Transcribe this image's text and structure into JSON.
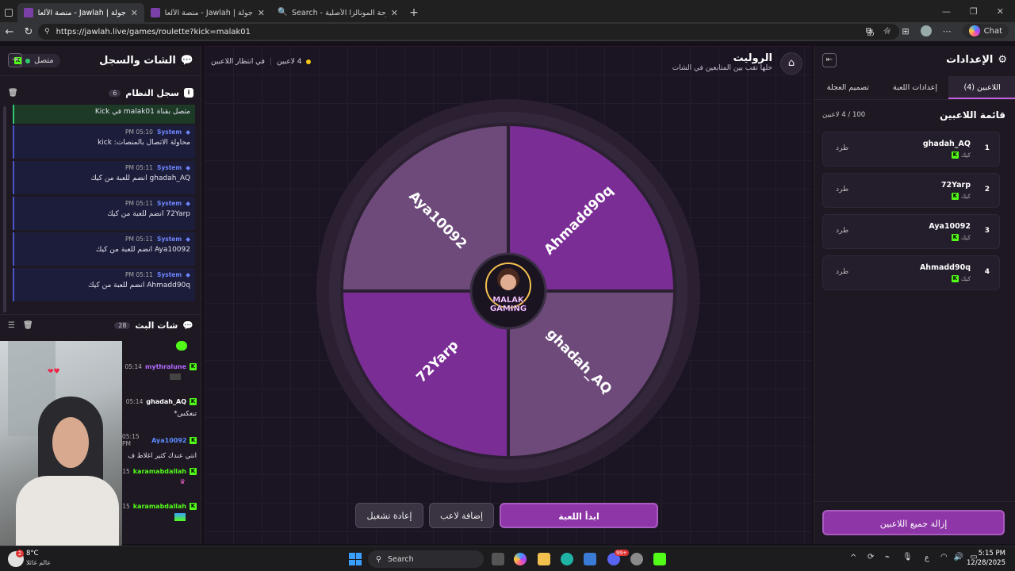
{
  "browser": {
    "tabs": [
      {
        "label": "جولة | Jawlah - منصة الألعاب التفاعلية",
        "active": true
      },
      {
        "label": "جولة | Jawlah - منصة الألعاب التفاعلية",
        "active": false
      },
      {
        "label": "Search - لوحة المونالزا الأصلية",
        "active": false
      }
    ],
    "url": "https://jawlah.live/games/roulette?kick=malak01",
    "chat_label": "Chat"
  },
  "left_panel": {
    "title": "الشات والسجل",
    "status": "متصل",
    "system_log": {
      "title": "سجل النظام",
      "count": "6",
      "first_entry": "متصل بقناة malak01 في Kick",
      "entries": [
        {
          "sender": "System",
          "time": "05:10 PM",
          "message": "محاولة الاتصال بالمنصات: kick"
        },
        {
          "sender": "System",
          "time": "05:11 PM",
          "message": "ghadah_AQ انضم للعبة من كيك"
        },
        {
          "sender": "System",
          "time": "05:11 PM",
          "message": "72Yarp انضم للعبة من كيك"
        },
        {
          "sender": "System",
          "time": "05:11 PM",
          "message": "Aya10092 انضم للعبة من كيك"
        },
        {
          "sender": "System",
          "time": "05:11 PM",
          "message": "Ahmadd90q انضم للعبة من كيك"
        }
      ]
    },
    "live_chat": {
      "title": "شات البث",
      "count": "28",
      "messages": [
        {
          "user": "mythralune",
          "time": "05:14",
          "text": ""
        },
        {
          "user": "ghadah_AQ",
          "time": "05:14",
          "text": "تنعكس*"
        },
        {
          "user": "Aya10092",
          "time": "05:15 PM",
          "text": "انتي عندك كثير اغلاط ف"
        },
        {
          "user": "karamabdallah",
          "time": "15",
          "text": ""
        },
        {
          "user": "karamabdallah",
          "time": "15",
          "text": ""
        }
      ]
    }
  },
  "center": {
    "title": "الروليت",
    "subtitle": "خلها تقب بين المتابعين في الشات",
    "players_count": "4 لاعبين",
    "waiting": "في انتظار اللاعبين",
    "logo_top": "MALAK",
    "logo_bottom": "GAMING",
    "wheel_segments": [
      "Ahmadd90q",
      "ghadah_AQ",
      "72Yarp",
      "Aya10092"
    ],
    "colors": {
      "seg_a": "#7b2d96",
      "seg_b": "#6d4a7a"
    },
    "buttons": {
      "start": "ابدأ اللعبة",
      "add": "إضافة لاعب",
      "restart": "إعادة تشغيل"
    }
  },
  "right_panel": {
    "title": "الإعدادات",
    "tabs": [
      "اللاعبين (4)",
      "إعدادات اللعبة",
      "تصميم العجلة"
    ],
    "list_title": "قائمة اللاعبين",
    "list_count": "100 / 4 لاعبين",
    "players": [
      {
        "num": "1",
        "name": "ghadah_AQ",
        "platform": "كيك",
        "kick": "طرد"
      },
      {
        "num": "2",
        "name": "72Yarp",
        "platform": "كيك",
        "kick": "طرد"
      },
      {
        "num": "3",
        "name": "Aya10092",
        "platform": "كيك",
        "kick": "طرد"
      },
      {
        "num": "4",
        "name": "Ahmadd90q",
        "platform": "كيك",
        "kick": "طرد"
      }
    ],
    "remove_all": "إزالة جميع اللاعبين"
  },
  "taskbar": {
    "weather_temp": "8°C",
    "weather_text": "عالم غائلا",
    "search": "Search",
    "lang": "ع",
    "time": "5:15 PM",
    "date": "12/28/2025",
    "badge": "99+"
  }
}
